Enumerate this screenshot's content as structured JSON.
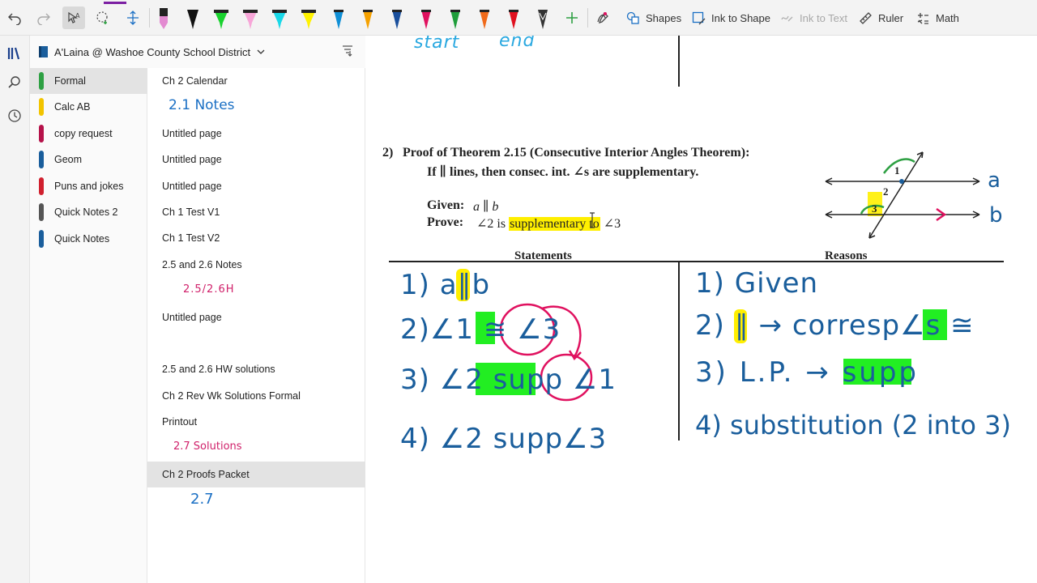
{
  "toolbar": {
    "shapes_label": "Shapes",
    "ink_to_shape_label": "Ink to Shape",
    "ink_to_text_label": "Ink to Text",
    "ruler_label": "Ruler",
    "math_label": "Math"
  },
  "notebook": {
    "name": "A'Laina @ Washoe County School District"
  },
  "sections": [
    {
      "label": "Formal",
      "color": "#2ea043"
    },
    {
      "label": "Calc AB",
      "color": "#f2c400"
    },
    {
      "label": "copy request",
      "color": "#b5124a"
    },
    {
      "label": "Geom",
      "color": "#1a5e9c"
    },
    {
      "label": "Puns and jokes",
      "color": "#d0202e"
    },
    {
      "label": "Quick Notes 2",
      "color": "#555555"
    },
    {
      "label": "Quick Notes",
      "color": "#1a5e9c"
    }
  ],
  "pages": [
    {
      "title": "Ch 2 Calendar",
      "sub": "2.1 Notes"
    },
    {
      "title": "Untitled page"
    },
    {
      "title": "Untitled page"
    },
    {
      "title": "Untitled page"
    },
    {
      "title": "Ch 1 Test V1"
    },
    {
      "title": "Ch 1 Test V2"
    },
    {
      "title": "2.5 and 2.6 Notes",
      "sub": "2.5/2.6H"
    },
    {
      "title": "Untitled page"
    },
    {
      "title": "2.5 and 2.6 HW solutions"
    },
    {
      "title": "Ch 2 Rev Wk Solutions Formal"
    },
    {
      "title": "Printout",
      "sub": "2.7 Solutions"
    },
    {
      "title": "Ch 2 Proofs Packet",
      "sub": "2.7"
    }
  ],
  "canvas": {
    "top_ink": {
      "start": "start",
      "end": "end"
    },
    "problem": {
      "number": "2)",
      "title": "Proof of Theorem 2.15 (Consecutive Interior Angles Theorem):",
      "statement": "If ∥ lines, then consec. int. ∠s are supplementary.",
      "given_label": "Given:",
      "given_value": "a ∥ b",
      "prove_label": "Prove:",
      "prove_pre": "∠2 is",
      "prove_highlight": "supplementary to",
      "prove_post": "∠3"
    },
    "diagram": {
      "line_a": "a",
      "line_b": "b",
      "angle_1": "1",
      "angle_2": "2",
      "angle_3": "3"
    },
    "table": {
      "statements_header": "Statements",
      "reasons_header": "Reasons",
      "statements": [
        {
          "num": "1)",
          "text": "a∥b"
        },
        {
          "num": "2)",
          "text": "∠1 ≅ ∠3"
        },
        {
          "num": "3)",
          "text": "∠2 supp ∠1"
        },
        {
          "num": "4)",
          "text": "∠2 supp∠3"
        }
      ],
      "reasons": [
        {
          "num": "1)",
          "text": "Given"
        },
        {
          "num": "2)",
          "text": "∥ → corresp∠s ≅"
        },
        {
          "num": "3)",
          "text": "L.P. → supp"
        },
        {
          "num": "4)",
          "text": "substitution (2 into 3)"
        }
      ]
    }
  }
}
